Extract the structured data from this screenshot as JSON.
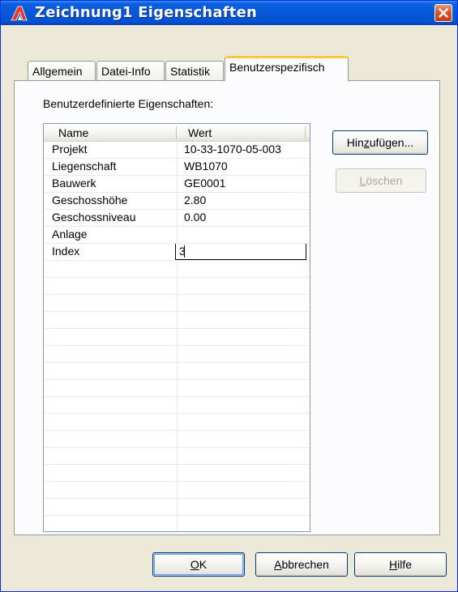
{
  "window": {
    "title": "Zeichnung1 Eigenschaften",
    "icon": "autocad-icon"
  },
  "tabs": [
    {
      "label": "Allgemein",
      "active": false
    },
    {
      "label": "Datei-Info",
      "active": false
    },
    {
      "label": "Statistik",
      "active": false
    },
    {
      "label": "Benutzerspezifisch",
      "active": true
    }
  ],
  "panel": {
    "section_label": "Benutzerdefinierte Eigenschaften:",
    "columns": {
      "name": "Name",
      "value": "Wert"
    },
    "rows": [
      {
        "name": "Projekt",
        "value": "10-33-1070-05-003"
      },
      {
        "name": "Liegenschaft",
        "value": "WB1070"
      },
      {
        "name": "Bauwerk",
        "value": "GE0001"
      },
      {
        "name": "Geschosshöhe",
        "value": "2.80"
      },
      {
        "name": "Geschossniveau",
        "value": "0.00"
      },
      {
        "name": "Anlage",
        "value": ""
      },
      {
        "name": "Index",
        "value": "3",
        "editing": true
      }
    ],
    "buttons": {
      "add": {
        "pre": "Hin",
        "mnemonic": "z",
        "post": "ufügen..."
      },
      "delete": {
        "pre": "",
        "mnemonic": "L",
        "post": "öschen",
        "disabled": true
      }
    }
  },
  "footer": {
    "ok": {
      "mnemonic": "O",
      "post": "K"
    },
    "cancel": {
      "mnemonic": "A",
      "post": "bbrechen"
    },
    "help": {
      "mnemonic": "H",
      "post": "ilfe"
    }
  },
  "colors": {
    "titlebar": "#0558d8",
    "active_tab_accent": "#ffc73c",
    "close_button": "#d9532d"
  }
}
